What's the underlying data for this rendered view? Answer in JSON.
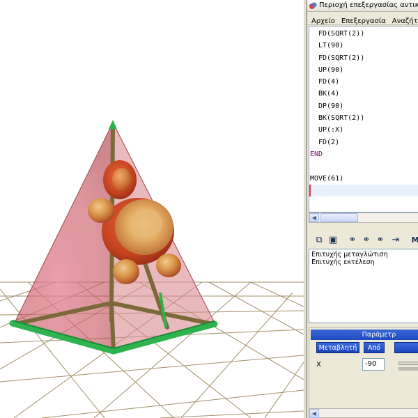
{
  "window": {
    "title": "Περιοχή επεξεργασίας αντικειμένω"
  },
  "menu": {
    "items": [
      "Αρχείο",
      "Επεξεργασία",
      "Αναζήτηση"
    ]
  },
  "editor": {
    "lines": [
      {
        "text": "FD(SQRT(2))",
        "kind": "code"
      },
      {
        "text": "LT(90)",
        "kind": "code"
      },
      {
        "text": "FD(SQRT(2))",
        "kind": "code"
      },
      {
        "text": "UP(90)",
        "kind": "code"
      },
      {
        "text": "FD(4)",
        "kind": "code"
      },
      {
        "text": "BK(4)",
        "kind": "code"
      },
      {
        "text": "DP(90)",
        "kind": "code"
      },
      {
        "text": "BK(SQRT(2))",
        "kind": "code"
      },
      {
        "text": "UP(:X)",
        "kind": "code"
      },
      {
        "text": "FD(2)",
        "kind": "code"
      },
      {
        "text": "END",
        "kind": "keyword"
      },
      {
        "text": "",
        "kind": "blank"
      },
      {
        "text": "MOVE(61)",
        "kind": "top"
      },
      {
        "text": "",
        "kind": "current"
      }
    ]
  },
  "toolbar": {
    "buttons": [
      {
        "icon": "copy-icon",
        "glyph": "⧉"
      },
      {
        "icon": "save-icon",
        "glyph": "▣"
      },
      {
        "icon": "binoculars-icon",
        "glyph": "⚭"
      },
      {
        "icon": "find-previous-icon",
        "glyph": "⚭"
      },
      {
        "icon": "find-next-icon",
        "glyph": "⚭"
      },
      {
        "icon": "insert-icon",
        "glyph": "⇥"
      },
      {
        "icon": "more-icon",
        "glyph": "M"
      }
    ]
  },
  "output": {
    "messages": [
      "Επιτυχής μεταγλώτιση",
      "Επιτυχής εκτέλεση"
    ]
  },
  "params": {
    "header": "Παράμετρ",
    "columns": [
      "Μεταβλητή",
      "Από"
    ],
    "rows": [
      {
        "variable": "X",
        "from": "-90"
      }
    ]
  },
  "colors": {
    "pyramid_fill": "#d46a6a",
    "frame_green": "#2fb34f",
    "pole_olive": "#7a6a3a",
    "grid_line": "#a28f6a",
    "header_blue": "#1e4bbd"
  }
}
